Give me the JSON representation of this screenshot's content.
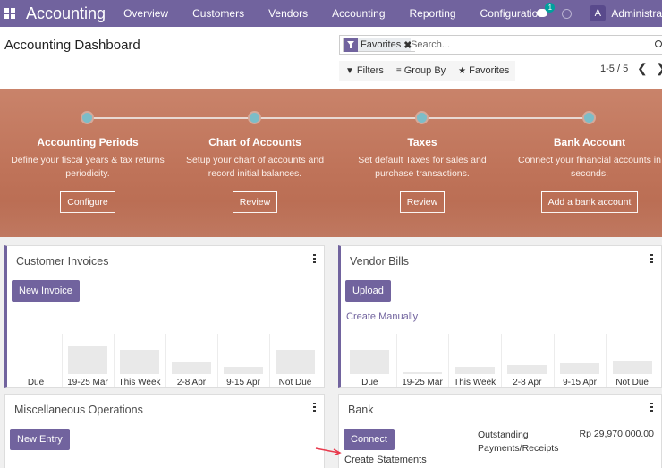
{
  "app": {
    "brand": "Accounting",
    "nav": [
      "Overview",
      "Customers",
      "Vendors",
      "Accounting",
      "Reporting",
      "Configuration"
    ],
    "chat_badge": "1",
    "user_initial": "A",
    "user_name": "Administra"
  },
  "control": {
    "title": "Accounting Dashboard",
    "facet_label": "Favorites",
    "facet_close": "✖",
    "search_placeholder": "Search...",
    "filters_label": "Filters",
    "groupby_label": "Group By",
    "favorites_label": "Favorites",
    "pager": "1-5 / 5",
    "prev": "❮",
    "next": "❯"
  },
  "onboarding": {
    "steps": [
      {
        "title": "Accounting Periods",
        "desc": "Define your fiscal years & tax returns periodicity.",
        "button": "Configure"
      },
      {
        "title": "Chart of Accounts",
        "desc": "Setup your chart of accounts and record initial balances.",
        "button": "Review"
      },
      {
        "title": "Taxes",
        "desc": "Set default Taxes for sales and purchase transactions.",
        "button": "Review"
      },
      {
        "title": "Bank Account",
        "desc": "Connect your financial accounts in seconds.",
        "button": "Add a bank account"
      }
    ]
  },
  "cards": {
    "customer_invoices": {
      "title": "Customer Invoices",
      "button": "New Invoice",
      "graph": {
        "labels": [
          "Due",
          "19-25 Mar",
          "This Week",
          "2-8 Apr",
          "9-15 Apr",
          "Not Due"
        ],
        "levels": [
          0,
          0.75,
          0.65,
          0.32,
          0.18,
          0.65
        ]
      }
    },
    "vendor_bills": {
      "title": "Vendor Bills",
      "button": "Upload",
      "link": "Create Manually",
      "graph": {
        "labels": [
          "Due",
          "19-25 Mar",
          "This Week",
          "2-8 Apr",
          "9-15 Apr",
          "Not Due"
        ],
        "levels": [
          0.65,
          0.05,
          0.18,
          0.25,
          0.28,
          0.35
        ]
      }
    },
    "misc": {
      "title": "Miscellaneous Operations",
      "button": "New Entry"
    },
    "bank": {
      "title": "Bank",
      "button": "Connect",
      "link": "Create Statements",
      "outstanding_label_1": "Outstanding",
      "outstanding_label_2": "Payments/Receipts",
      "amount": "Rp 29,970,000.00"
    }
  },
  "colors": {
    "brand": "#71639e",
    "banner": "#bf7359",
    "step_dot": "#7cbdc8"
  }
}
